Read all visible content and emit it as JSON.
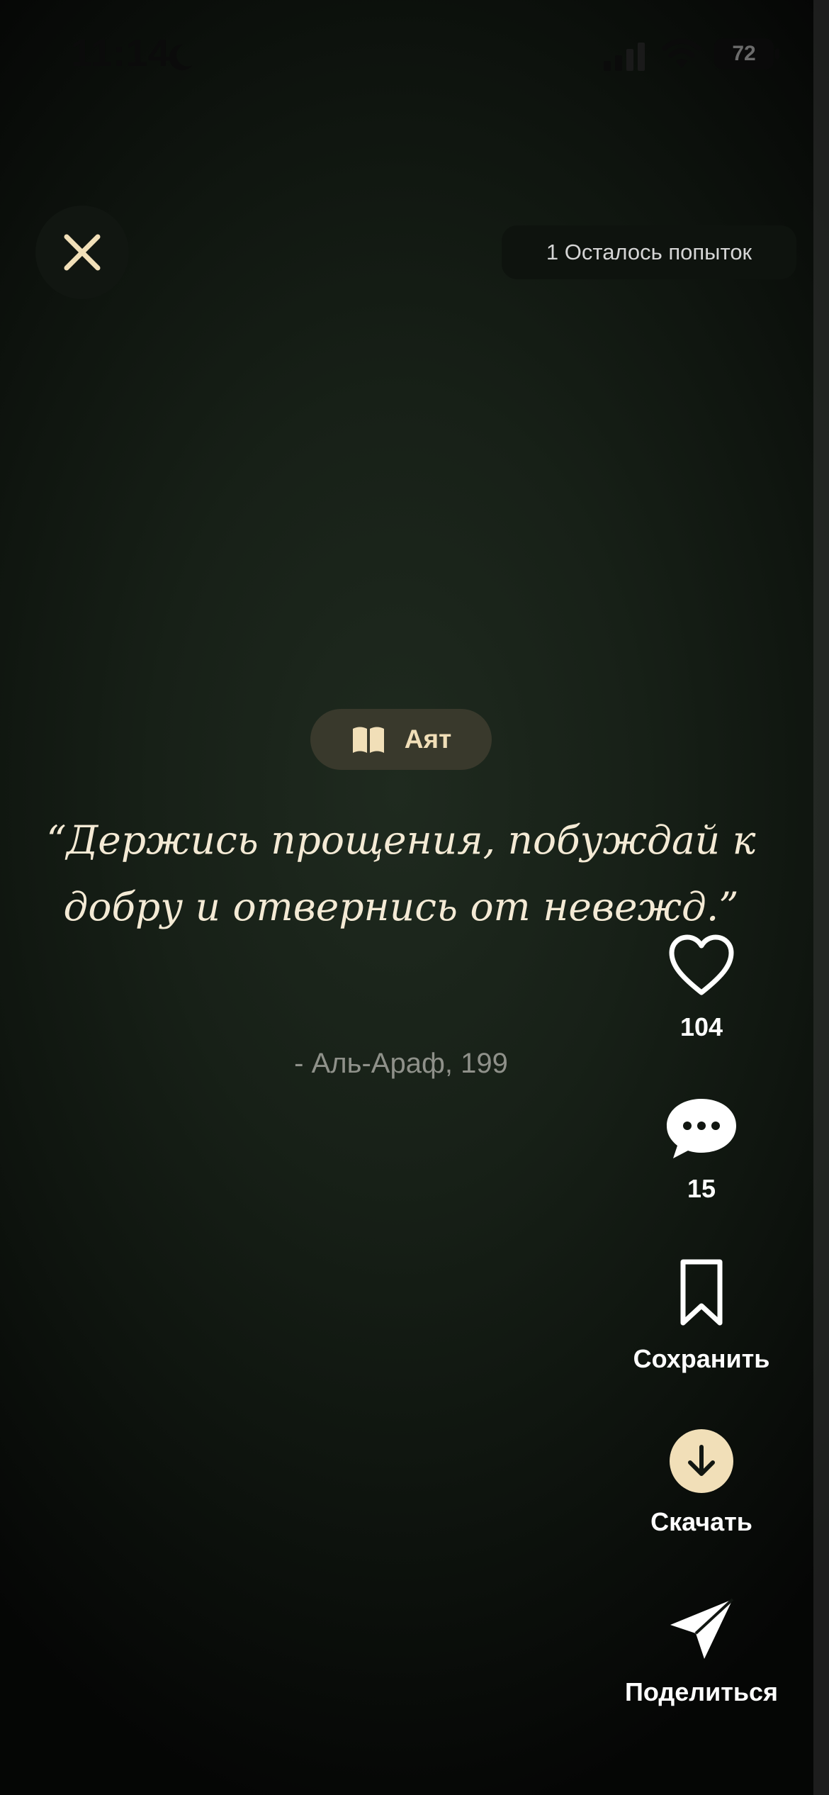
{
  "status_bar": {
    "time": "11:14",
    "battery": "72",
    "icons": [
      "moon-icon",
      "signal-icon",
      "wifi-icon",
      "battery-icon"
    ]
  },
  "header": {
    "close_icon": "close-icon",
    "attempts_label": "1 Осталось попыток"
  },
  "card": {
    "category_label": "Аят",
    "category_icon": "book-icon",
    "quote": "“Держись прощения, побуждай к добру и отвернись от невежд.”",
    "source": "- Аль-Араф, 199"
  },
  "actions": {
    "like": {
      "icon": "heart-icon",
      "count": "104"
    },
    "comment": {
      "icon": "comment-bubble-icon",
      "count": "15"
    },
    "save": {
      "icon": "bookmark-icon",
      "label": "Сохранить"
    },
    "download": {
      "icon": "download-arrow-icon",
      "label": "Скачать"
    },
    "share": {
      "icon": "paper-plane-icon",
      "label": "Поделиться"
    }
  },
  "colors": {
    "accent": "#f1dfb8",
    "quote_text": "#f4ead5",
    "background": "#172017",
    "source_text": "#8f918a"
  }
}
